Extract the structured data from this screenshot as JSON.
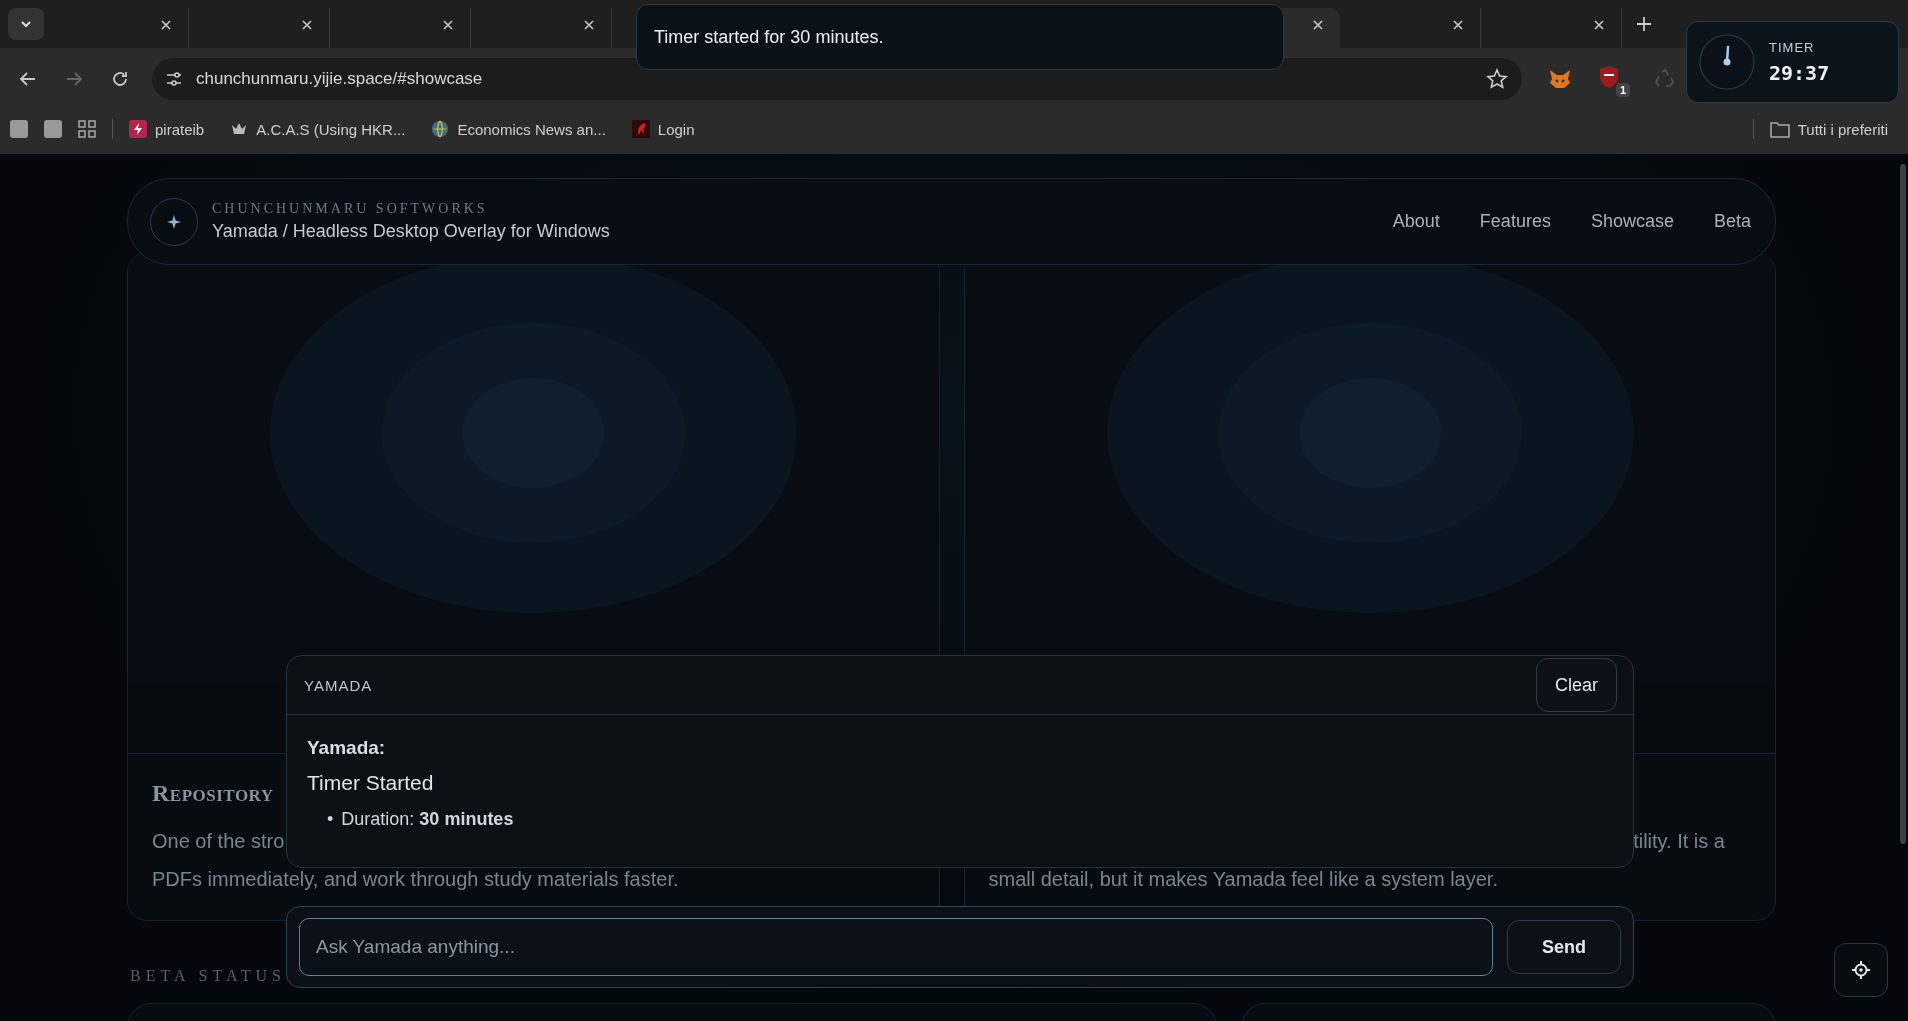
{
  "browser": {
    "tabs": [
      {
        "selected": false
      },
      {
        "selected": false
      },
      {
        "selected": false
      },
      {
        "selected": false
      },
      {
        "selected": true
      },
      {
        "selected": false
      },
      {
        "selected": false
      }
    ],
    "address": "chunchunmaru.yijie.space/#showcase",
    "extension_badge": "1",
    "bookmarks": [
      {
        "label": "pirateib",
        "kind": "bolt"
      },
      {
        "label": "A.C.A.S (Using HKR...",
        "kind": "crown"
      },
      {
        "label": "Economics News an...",
        "kind": "globe"
      },
      {
        "label": "Login",
        "kind": "login"
      }
    ],
    "all_bookmarks": "Tutti i preferiti"
  },
  "toast": {
    "message": "Timer started for 30 minutes."
  },
  "timer": {
    "label": "TIMER",
    "time": "29:37"
  },
  "header": {
    "brand": "CHUNCHUNMARU SOFTWORKS",
    "subtitle": "Yamada / Headless Desktop Overlay for Windows",
    "nav": [
      "About",
      "Features",
      "Showcase",
      "Beta"
    ]
  },
  "showcase": [
    {
      "title": "Repository",
      "lines": [
        {
          "kind": "head",
          "text": "One of the stro"
        },
        {
          "kind": "full",
          "text": "PDFs immediately, and work through study materials faster."
        }
      ]
    },
    {
      "lines": [
        {
          "kind": "tail",
          "text": "tility. It is a"
        },
        {
          "kind": "full",
          "text": "small detail, but it makes Yamada feel like a system layer."
        }
      ]
    }
  ],
  "section_label": "BETA STATUS",
  "chat": {
    "title": "YAMADA",
    "clear": "Clear",
    "messages": [
      {
        "sender": "Yamada:",
        "heading": "Timer Started",
        "items": [
          {
            "bullet": "•",
            "text": "Duration: **30 minutes**"
          }
        ]
      }
    ],
    "placeholder": "Ask Yamada anything...",
    "send": "Send"
  }
}
